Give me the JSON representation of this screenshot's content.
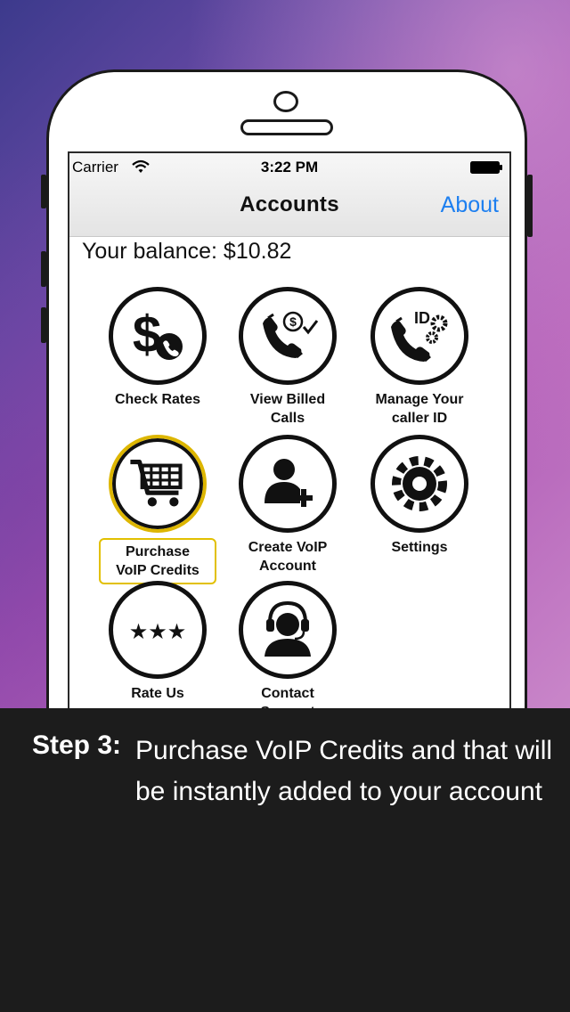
{
  "status_bar": {
    "carrier": "Carrier",
    "time": "3:22 PM"
  },
  "nav": {
    "title": "Accounts",
    "about_label": "About"
  },
  "balance_text": "Your balance: $10.82",
  "menu": [
    {
      "label": "Check Rates",
      "icon": "dollar-phone-icon"
    },
    {
      "label": "View Billed\nCalls",
      "icon": "phone-receipt-icon"
    },
    {
      "label": "Manage Your\ncaller ID",
      "icon": "caller-id-settings-icon"
    },
    {
      "label": "Purchase\nVoIP Credits",
      "icon": "shopping-cart-icon",
      "selected": true
    },
    {
      "label": "Create VoIP\nAccount",
      "icon": "add-user-icon"
    },
    {
      "label": "Settings",
      "icon": "gear-icon"
    },
    {
      "label": "Rate Us",
      "icon": "three-stars-icon"
    },
    {
      "label": "Contact\nSupport",
      "icon": "headset-agent-icon"
    }
  ],
  "caption": {
    "step_label": "Step 3:",
    "text": "Purchase VoIP Credits and that will be instantly added to your account"
  },
  "colors": {
    "accent": "#1d7ff0",
    "highlight": "#e2c000",
    "caption_bg": "#1c1c1c"
  }
}
